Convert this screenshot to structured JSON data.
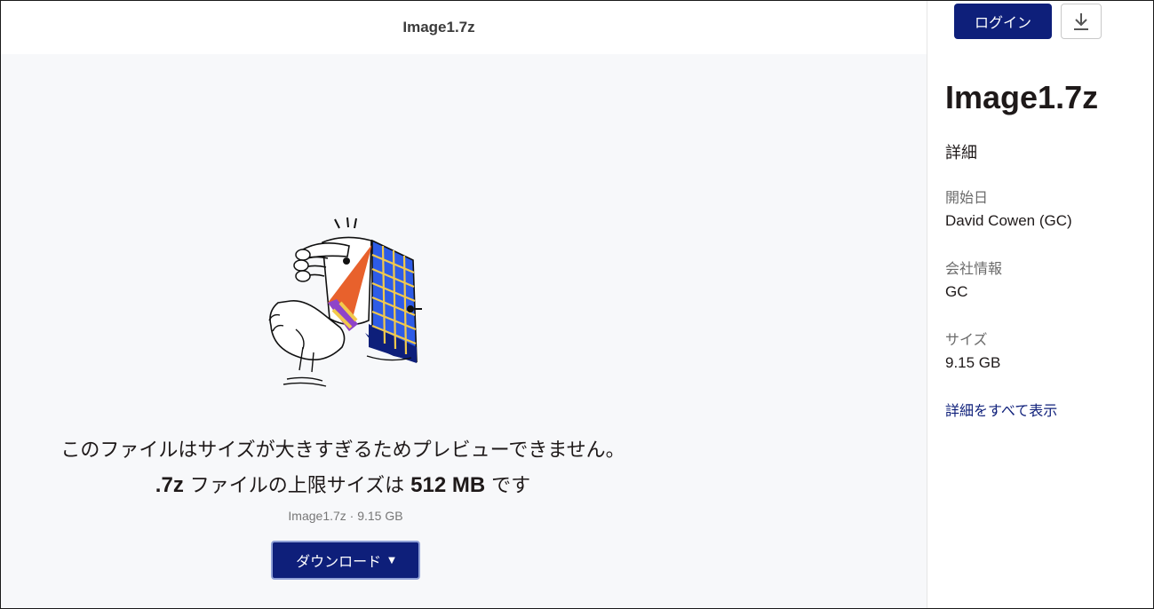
{
  "header": {
    "file_title": "Image1.7z"
  },
  "main": {
    "message_line1": "このファイルはサイズが大きすぎるためプレビューできません。",
    "message_line2_ext": ".7z",
    "message_line2_mid": " ファイルの上限サイズは ",
    "message_line2_limit": "512 MB",
    "message_line2_end": " です",
    "file_info": "Image1.7z · 9.15 GB",
    "download_button": "ダウンロード",
    "download_caret": "▼"
  },
  "sidebar": {
    "login_button": "ログイン",
    "download_icon": "download-icon",
    "title": "Image1.7z",
    "section_heading": "詳細",
    "fields": [
      {
        "label": "開始日",
        "value": "David Cowen (GC)"
      },
      {
        "label": "会社情報",
        "value": "GC"
      },
      {
        "label": "サイズ",
        "value": "9.15 GB"
      }
    ],
    "show_all_link": "詳細をすべて表示"
  },
  "colors": {
    "primary_button": "#0e1f7a",
    "preview_background": "#f7f8fa",
    "illustration_orange": "#e8612c",
    "illustration_blue": "#2e5ce6",
    "illustration_navy": "#0e1f7a",
    "illustration_yellow": "#f2c94c",
    "illustration_purple": "#8e44c9"
  }
}
